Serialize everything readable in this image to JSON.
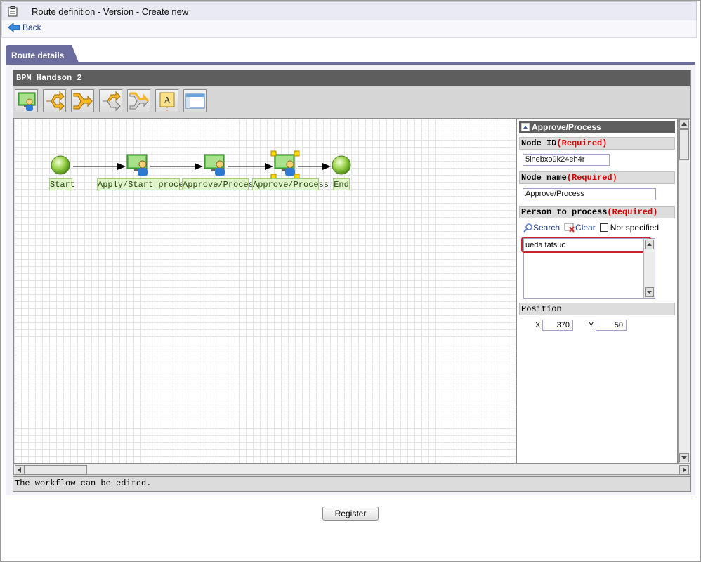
{
  "window": {
    "title": "Route definition - Version - Create new"
  },
  "nav": {
    "back_label": "Back"
  },
  "tabs": [
    {
      "label": "Route details",
      "active": true
    }
  ],
  "editor": {
    "route_name": "BPM Handson 2",
    "toolbar": [
      {
        "name": "process-node-tool",
        "icon": "user-monitor-icon"
      },
      {
        "name": "branch-tool",
        "icon": "branch-arrow-icon"
      },
      {
        "name": "merge-tool",
        "icon": "merge-arrow-icon"
      },
      {
        "name": "branch-gray-tool",
        "icon": "branch-gray-icon"
      },
      {
        "name": "merge-gray-tool",
        "icon": "merge-gray-icon"
      },
      {
        "name": "text-tool",
        "icon": "text-note-icon"
      },
      {
        "name": "window-tool",
        "icon": "window-icon"
      }
    ],
    "nodes": [
      {
        "label": "Start",
        "type": "start"
      },
      {
        "label": "Apply/Start process",
        "type": "process"
      },
      {
        "label": "Approve/Process",
        "type": "process"
      },
      {
        "label": "Approve/Process",
        "type": "process",
        "selected": true
      },
      {
        "label": "End",
        "type": "end"
      }
    ],
    "status": "The workflow can be edited."
  },
  "panel": {
    "title": "Approve/Process",
    "node_id": {
      "label": "Node ID",
      "required": "(Required)",
      "value": "5inebxo9k24eh4r"
    },
    "node_name": {
      "label": "Node name",
      "required": "(Required)",
      "value": "Approve/Process"
    },
    "person": {
      "label": "Person to process",
      "required": "(Required)",
      "search": "Search",
      "clear": "Clear",
      "not_specified": "Not specified",
      "selected": "ueda tatsuo"
    },
    "position": {
      "label": "Position",
      "x_label": "X",
      "x_value": "370",
      "y_label": "Y",
      "y_value": "50"
    }
  },
  "footer": {
    "register_label": "Register"
  },
  "colors": {
    "accent": "#6b6d9e",
    "required": "#d80000",
    "selection": "#c8262c",
    "node_label_bg": "#e2f4c9"
  }
}
